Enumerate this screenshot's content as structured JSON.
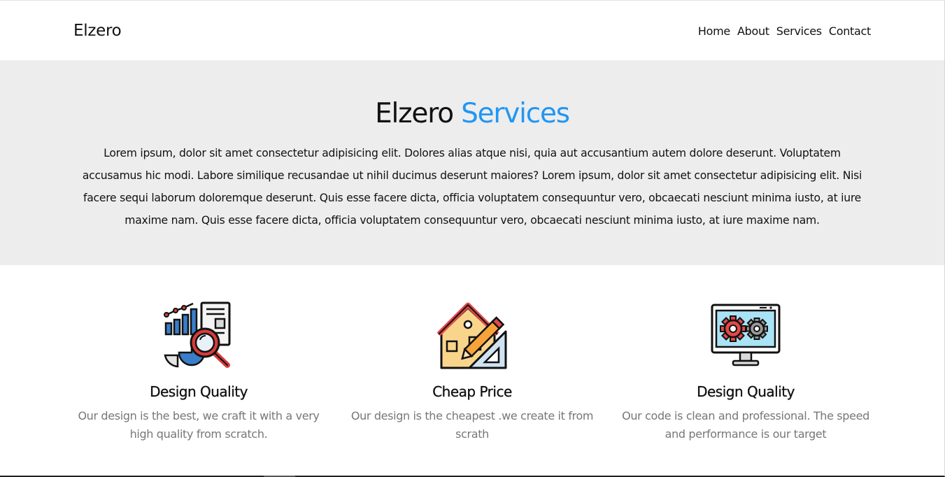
{
  "header": {
    "logo": "Elzero",
    "nav": [
      "Home",
      "About",
      "Services",
      "Contact"
    ]
  },
  "hero": {
    "title_main": "Elzero",
    "title_accent": "Services",
    "text": "Lorem ipsum, dolor sit amet consectetur adipisicing elit. Dolores alias atque nisi, quia aut accusantium autem dolore deserunt. Voluptatem accusamus hic modi. Labore similique recusandae ut nihil ducimus deserunt maiores? Lorem ipsum, dolor sit amet consectetur adipisicing elit. Nisi facere sequi laborum doloremque deserunt. Quis esse facere dicta, officia voluptatem consequuntur vero, obcaecati nesciunt minima iusto, at iure maxime nam. Quis esse facere dicta, officia voluptatem consequuntur vero, obcaecati nesciunt minima iusto, at iure maxime nam."
  },
  "features": [
    {
      "icon": "analytics-magnifier-icon",
      "title": "Design Quality",
      "text": "Our design is the best, we craft it with a very high quality from scratch."
    },
    {
      "icon": "house-pencil-ruler-icon",
      "title": "Cheap Price",
      "text": "Our design is the cheapest .we create it from scrath"
    },
    {
      "icon": "monitor-gears-icon",
      "title": "Design Quality",
      "text": "Our code is clean and professional. The speed and performance is our target"
    }
  ],
  "colors": {
    "accent": "#2196f3",
    "hero_bg": "#ededed",
    "muted_text": "#777777"
  }
}
